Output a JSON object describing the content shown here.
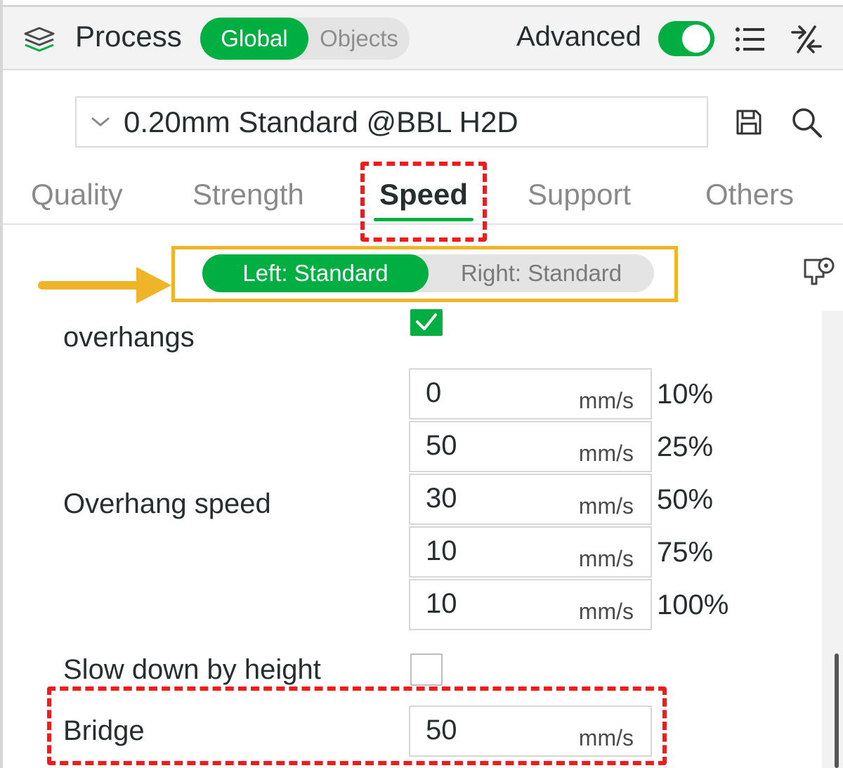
{
  "header": {
    "title": "Process",
    "scope_tabs": [
      {
        "label": "Global",
        "selected": true
      },
      {
        "label": "Objects",
        "selected": false
      }
    ],
    "advanced_label": "Advanced",
    "advanced_enabled": true
  },
  "preset": {
    "name": "0.20mm Standard @BBL H2D"
  },
  "tabs": [
    {
      "label": "Quality"
    },
    {
      "label": "Strength"
    },
    {
      "label": "Speed",
      "selected": true
    },
    {
      "label": "Support"
    },
    {
      "label": "Others"
    }
  ],
  "extruder_switch": {
    "left": "Left: Standard",
    "right": "Right: Standard",
    "selected": "left"
  },
  "settings": {
    "overhangs_label": "overhangs",
    "overhangs_checked": true,
    "overhang_speed_label": "Overhang speed",
    "overhang_rows": [
      {
        "value": "0",
        "unit": "mm/s",
        "percent": "10%"
      },
      {
        "value": "50",
        "unit": "mm/s",
        "percent": "25%"
      },
      {
        "value": "30",
        "unit": "mm/s",
        "percent": "50%"
      },
      {
        "value": "10",
        "unit": "mm/s",
        "percent": "75%"
      },
      {
        "value": "10",
        "unit": "mm/s",
        "percent": "100%"
      }
    ],
    "slow_down_label": "Slow down by height",
    "slow_down_checked": false,
    "bridge_label": "Bridge",
    "bridge_value": "50",
    "bridge_unit": "mm/s"
  },
  "colors": {
    "accent": "#00ae42",
    "highlight_red": "#ee1c1c",
    "highlight_yellow": "#f0b429"
  },
  "icons": [
    "layers-icon",
    "list-icon",
    "compare-icon",
    "save-icon",
    "search-icon",
    "chevron-down-icon",
    "arrow-right-icon",
    "extruder-settings-icon",
    "checkmark-icon"
  ]
}
